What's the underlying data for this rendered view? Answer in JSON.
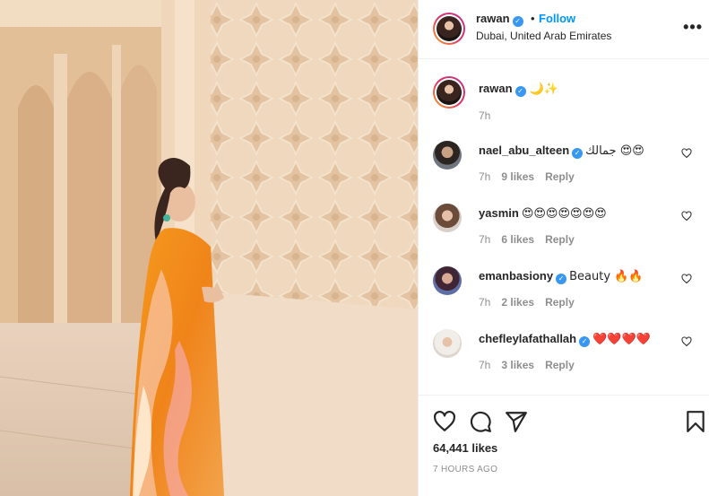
{
  "header": {
    "username": "rawan",
    "separator": "•",
    "follow_label": "Follow",
    "location": "Dubai, United Arab Emirates",
    "more_icon": "more-horizontal-icon",
    "more_label": "•••"
  },
  "caption": {
    "username": "rawan",
    "text": "🌙✨",
    "time": "7h"
  },
  "comments": [
    {
      "username": "nael_abu_alteen",
      "verified": true,
      "text": "جمالك 😍😍",
      "time": "7h",
      "likes": "9 likes",
      "reply": "Reply"
    },
    {
      "username": "yasmin",
      "verified": false,
      "text": "😍😍😍😍😍😍😍",
      "time": "7h",
      "likes": "6 likes",
      "reply": "Reply"
    },
    {
      "username": "emanbasiony",
      "verified": true,
      "text": "Beauty 🔥🔥",
      "time": "7h",
      "likes": "2 likes",
      "reply": "Reply"
    },
    {
      "username": "chefleylafathallah",
      "verified": true,
      "text": "❤️❤️❤️❤️",
      "time": "7h",
      "likes": "3 likes",
      "reply": "Reply"
    }
  ],
  "actions": {
    "like_icon": "heart-icon",
    "comment_icon": "comment-icon",
    "share_icon": "share-icon",
    "save_icon": "bookmark-icon",
    "likes_count": "64,441 likes",
    "posted": "7 HOURS AGO"
  },
  "colors": {
    "accent": "#0095f6",
    "verified": "#3897f0",
    "muted": "#8e8e8e",
    "dress": "#f0841a"
  }
}
